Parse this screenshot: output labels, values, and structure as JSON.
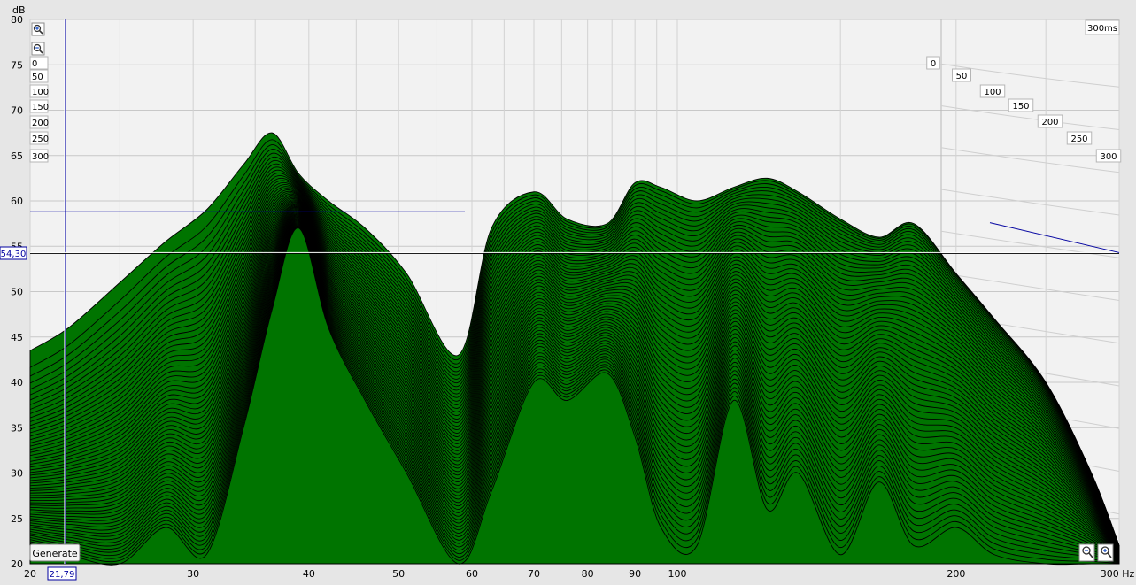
{
  "units": {
    "y": "dB",
    "x": "Hz"
  },
  "time_window_label": "300ms",
  "cursor": {
    "x_readout": "21,79",
    "y_readout": "54,30"
  },
  "buttons": {
    "generate": "Generate"
  },
  "colors": {
    "fill": "#007400",
    "stroke": "#000000",
    "cursor": "#0000a0",
    "background": "#e6e6e6",
    "plot_bg": "#f2f2f2"
  },
  "icons": [
    "zoom-in-icon",
    "zoom-out-icon",
    "zoom-fit-icon",
    "zoom-reset-icon"
  ],
  "chart_data": {
    "type": "area",
    "kind": "waterfall",
    "xscale": "log",
    "xlim": [
      20,
      300
    ],
    "ylim": [
      20,
      80
    ],
    "y_ticks": [
      20,
      25,
      30,
      35,
      40,
      45,
      50,
      55,
      60,
      65,
      70,
      75,
      80
    ],
    "x_ticks": [
      20,
      30,
      40,
      50,
      60,
      70,
      80,
      90,
      100,
      200,
      300
    ],
    "x_tick_labels": [
      "20",
      "30",
      "40",
      "50",
      "60",
      "70",
      "80",
      "90",
      "100",
      "200",
      "300 Hz"
    ],
    "time_ticks_ms": [
      "0",
      "50",
      "100",
      "150",
      "200",
      "250",
      "300"
    ],
    "slice_count": 60,
    "series": [
      {
        "time_ms": 0,
        "x": [
          20,
          22,
          25,
          28,
          31,
          34,
          36.5,
          39,
          42,
          46,
          51,
          58,
          63,
          70,
          76,
          84,
          90,
          96,
          105,
          115,
          125,
          135,
          150,
          165,
          180,
          200,
          220,
          250,
          280,
          300
        ],
        "values": [
          43.5,
          46,
          51,
          55.5,
          59,
          64,
          67.5,
          63,
          60,
          57,
          52,
          43,
          57,
          61,
          58,
          57.5,
          62,
          61.5,
          60,
          61.5,
          62.5,
          61,
          58,
          56,
          57.5,
          52,
          47,
          40,
          30,
          22
        ]
      },
      {
        "time_ms": 300,
        "x": [
          20,
          22,
          25,
          28,
          31,
          34,
          36.5,
          39,
          42,
          46,
          51,
          58,
          63,
          70,
          76,
          84,
          90,
          96,
          105,
          115,
          125,
          135,
          150,
          165,
          180,
          200,
          220,
          250,
          280,
          300
        ],
        "values": [
          22,
          21,
          20,
          24,
          21,
          35,
          48,
          57,
          46,
          38,
          30,
          20,
          28,
          40,
          38,
          41,
          34,
          24,
          22,
          38,
          26,
          30,
          21,
          29,
          22,
          24,
          21,
          20,
          20,
          20
        ]
      }
    ]
  }
}
